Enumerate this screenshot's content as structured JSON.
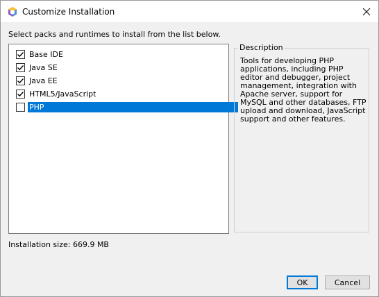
{
  "window": {
    "title": "Customize Installation",
    "close_glyph": "✕"
  },
  "instruction": "Select packs and runtimes to install from the list below.",
  "packs": [
    {
      "label": "Base IDE",
      "checked": true,
      "selected": false
    },
    {
      "label": "Java SE",
      "checked": true,
      "selected": false
    },
    {
      "label": "Java EE",
      "checked": true,
      "selected": false
    },
    {
      "label": "HTML5/JavaScript",
      "checked": true,
      "selected": false
    },
    {
      "label": "PHP",
      "checked": false,
      "selected": true
    }
  ],
  "description": {
    "legend": "Description",
    "text": "Tools for developing PHP applications, including PHP editor and debugger, project management, integration with Apache server, support for MySQL and other databases, FTP upload and download, JavaScript support and other features."
  },
  "installation_size": "Installation size: 669.9 MB",
  "buttons": {
    "ok": "OK",
    "cancel": "Cancel"
  },
  "colors": {
    "selection": "#0078d7",
    "title_bar": "#ffffff",
    "dialog_bg": "#f0f0f0"
  }
}
